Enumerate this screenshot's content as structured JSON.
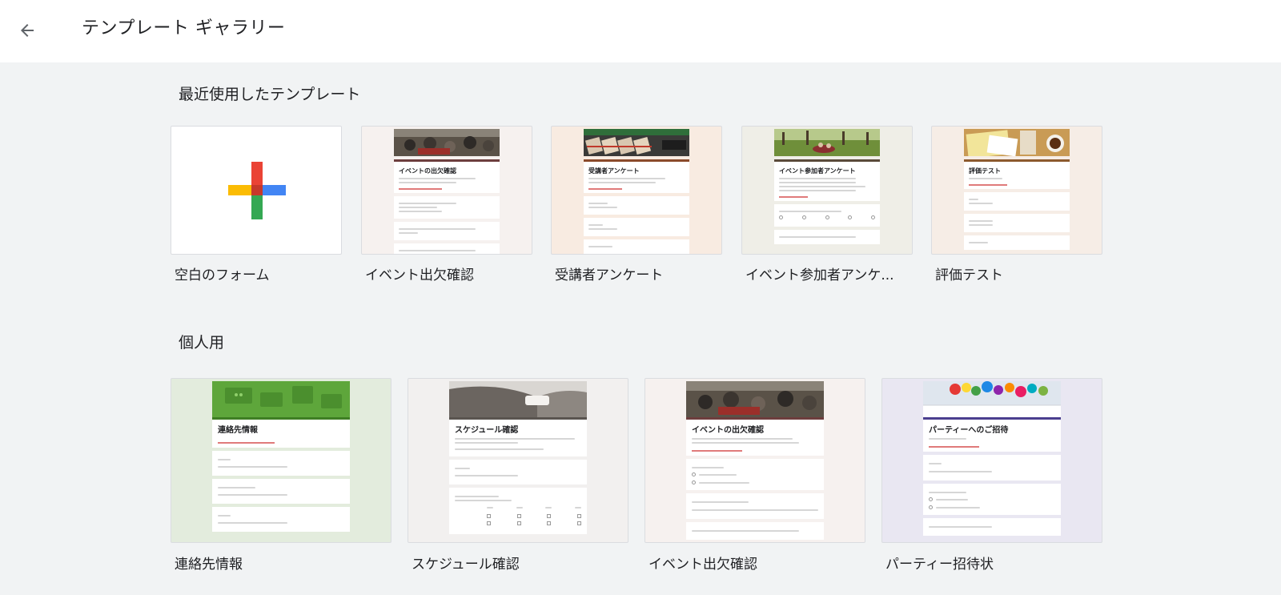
{
  "header": {
    "title": "テンプレート ギャラリー",
    "back_icon": "arrow-back-icon"
  },
  "sections": {
    "recent": {
      "title": "最近使用したテンプレート",
      "items": [
        {
          "label": "空白のフォーム"
        },
        {
          "label": "イベント出欠確認",
          "preview_title": "イベントの出欠確認"
        },
        {
          "label": "受講者アンケート",
          "preview_title": "受講者アンケート"
        },
        {
          "label": "イベント参加者アンケ...",
          "preview_title": "イベント参加者アンケート"
        },
        {
          "label": "評価テスト",
          "preview_title": "評価テスト"
        }
      ]
    },
    "personal": {
      "title": "個人用",
      "items": [
        {
          "label": "連絡先情報",
          "preview_title": "連絡先情報"
        },
        {
          "label": "スケジュール確認",
          "preview_title": "スケジュール確認"
        },
        {
          "label": "イベント出欠確認",
          "preview_title": "イベントの出欠確認"
        },
        {
          "label": "パーティー招待状",
          "preview_title": "パーティーへのご招待"
        }
      ]
    }
  },
  "colors": {
    "plus_red": "#ea4335",
    "plus_blue": "#4285f4",
    "plus_green": "#34a853",
    "plus_yellow": "#fbbc04"
  }
}
